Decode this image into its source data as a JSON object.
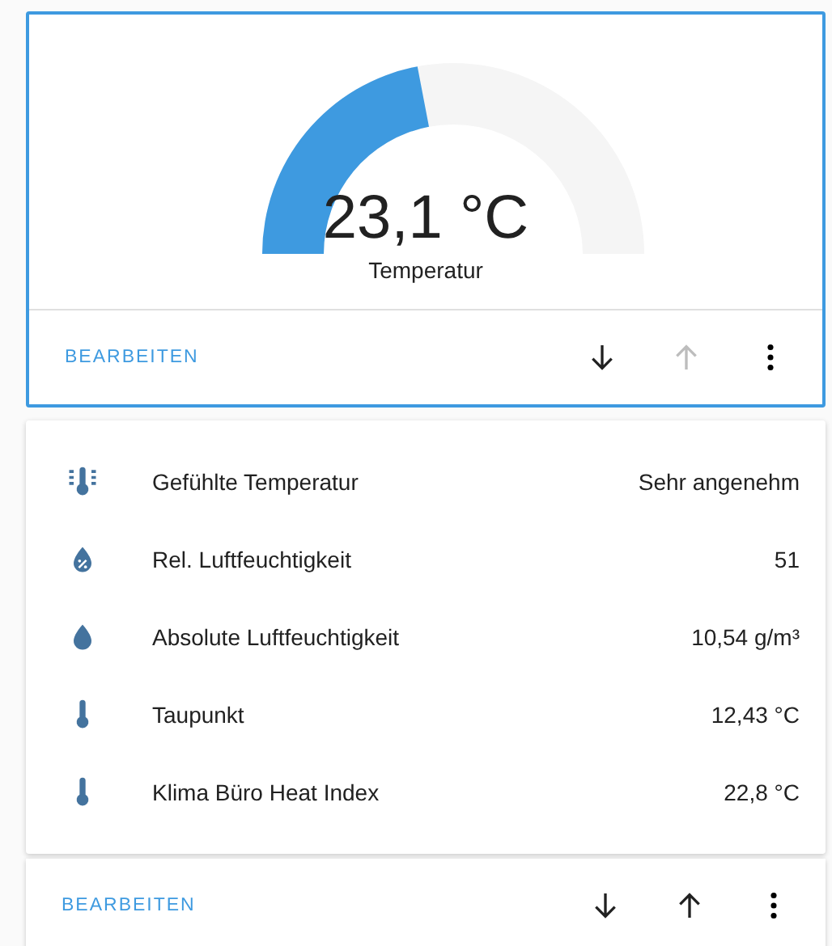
{
  "cards": [
    {
      "kind": "gauge",
      "selected": true,
      "gauge": {
        "value": "23,1 °C",
        "name": "Temperatur"
      },
      "footer": {
        "edit": "BEARBEITEN",
        "move_down_disabled": false,
        "move_up_disabled": true
      }
    },
    {
      "kind": "entities",
      "selected": false,
      "entities": [
        {
          "kind": "thermometer-lines",
          "name": "Gefühlte Temperatur",
          "state": "Sehr angenehm"
        },
        {
          "kind": "water-percent",
          "name": "Rel. Luftfeuchtigkeit",
          "state": "51"
        },
        {
          "kind": "water",
          "name": "Absolute Luftfeuchtigkeit",
          "state": "10,54 g/m³"
        },
        {
          "kind": "thermometer",
          "name": "Taupunkt",
          "state": "12,43 °C"
        },
        {
          "kind": "thermometer",
          "name": "Klima Büro Heat Index",
          "state": "22,8 °C"
        }
      ],
      "footer": {
        "edit": "BEARBEITEN",
        "move_down_disabled": false,
        "move_up_disabled": false
      }
    }
  ]
}
